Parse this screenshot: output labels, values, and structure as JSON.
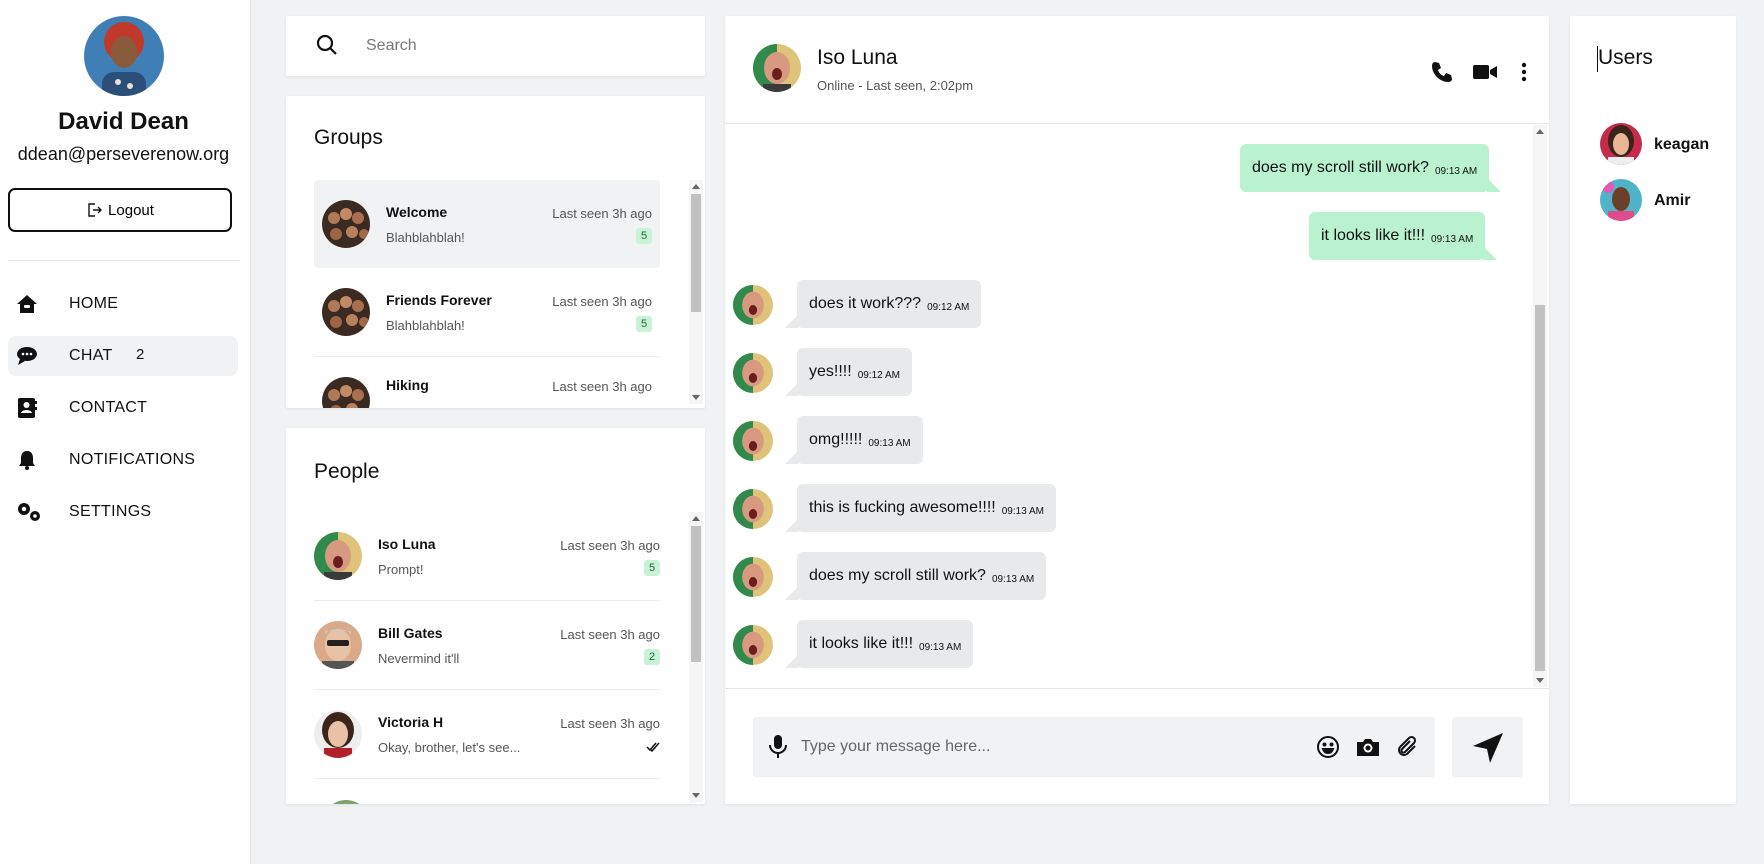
{
  "profile": {
    "name": "David Dean",
    "email": "ddean@perseverenow.org",
    "logout_label": "Logout"
  },
  "nav": {
    "items": [
      {
        "label": "HOME",
        "icon": "home-icon"
      },
      {
        "label": "CHAT",
        "icon": "chat-icon",
        "badge": "2",
        "active": true
      },
      {
        "label": "CONTACT",
        "icon": "contact-book-icon"
      },
      {
        "label": "NOTIFICATIONS",
        "icon": "bell-icon"
      },
      {
        "label": "SETTINGS",
        "icon": "gears-icon"
      }
    ]
  },
  "search": {
    "placeholder": "Search"
  },
  "groups": {
    "title": "Groups",
    "items": [
      {
        "name": "Welcome",
        "preview": "Blahblahblah!",
        "time": "Last seen 3h ago",
        "badge": "5"
      },
      {
        "name": "Friends Forever",
        "preview": "Blahblahblah!",
        "time": "Last seen 3h ago",
        "badge": "5"
      },
      {
        "name": "Hiking",
        "preview": "",
        "time": "Last seen 3h ago",
        "badge": ""
      }
    ]
  },
  "people": {
    "title": "People",
    "items": [
      {
        "name": "Iso Luna",
        "preview": "Prompt!",
        "time": "Last seen 3h ago",
        "badge": "5"
      },
      {
        "name": "Bill Gates",
        "preview": "Nevermind it'll",
        "time": "Last seen 3h ago",
        "badge": "2"
      },
      {
        "name": "Victoria H",
        "preview": "Okay, brother, let's see...",
        "time": "Last seen 3h ago",
        "badge": ""
      }
    ]
  },
  "chat": {
    "name": "Iso Luna",
    "status": "Online - Last seen, 2:02pm",
    "messages": [
      {
        "direction": "out",
        "text": "does my scroll still work?",
        "time": "09:13 AM"
      },
      {
        "direction": "out",
        "text": "it looks like it!!!",
        "time": "09:13 AM"
      },
      {
        "direction": "in",
        "text": "does it work???",
        "time": "09:12 AM"
      },
      {
        "direction": "in",
        "text": "yes!!!!",
        "time": "09:12 AM"
      },
      {
        "direction": "in",
        "text": "omg!!!!!",
        "time": "09:13 AM"
      },
      {
        "direction": "in",
        "text": "this is fucking awesome!!!!",
        "time": "09:13 AM"
      },
      {
        "direction": "in",
        "text": "does my scroll still work?",
        "time": "09:13 AM"
      },
      {
        "direction": "in",
        "text": "it looks like it!!!",
        "time": "09:13 AM"
      }
    ],
    "input_placeholder": "Type your message here..."
  },
  "users": {
    "title": "Users",
    "items": [
      {
        "name": "keagan"
      },
      {
        "name": "Amir"
      }
    ]
  },
  "colors": {
    "outgoing_bubble": "#b9f2cf",
    "incoming_bubble": "#e8e9eb",
    "badge_bg": "#c9f3d6",
    "page_bg": "#f1f2f4"
  }
}
